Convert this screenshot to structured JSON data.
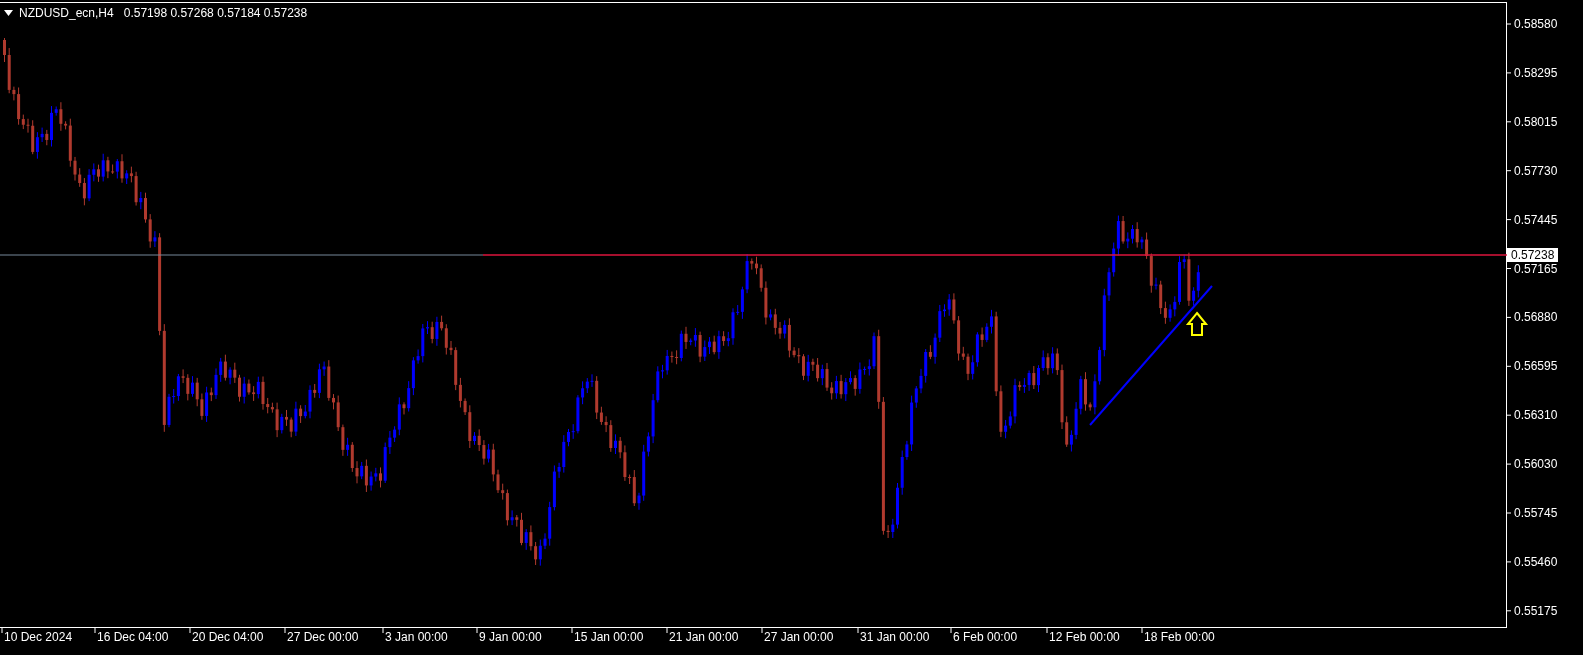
{
  "header": {
    "symbol": "NZDUSD_ecn,H4",
    "ohlc": "0.57198 0.57268 0.57184 0.57238"
  },
  "price_axis": {
    "labels": [
      "0.58580",
      "0.58295",
      "0.58015",
      "0.57730",
      "0.57445",
      "0.57165",
      "0.56880",
      "0.56595",
      "0.56310",
      "0.56030",
      "0.55745",
      "0.55460",
      "0.55175"
    ],
    "current_price": "0.57238"
  },
  "time_axis": {
    "labels": [
      "10 Dec 2024",
      "16 Dec 04:00",
      "20 Dec 04:00",
      "27 Dec 00:00",
      "3 Jan 00:00",
      "9 Jan 00:00",
      "15 Jan 00:00",
      "21 Jan 00:00",
      "27 Jan 00:00",
      "31 Jan 00:00",
      "6 Feb 00:00",
      "12 Feb 00:00",
      "18 Feb 00:00"
    ]
  }
}
